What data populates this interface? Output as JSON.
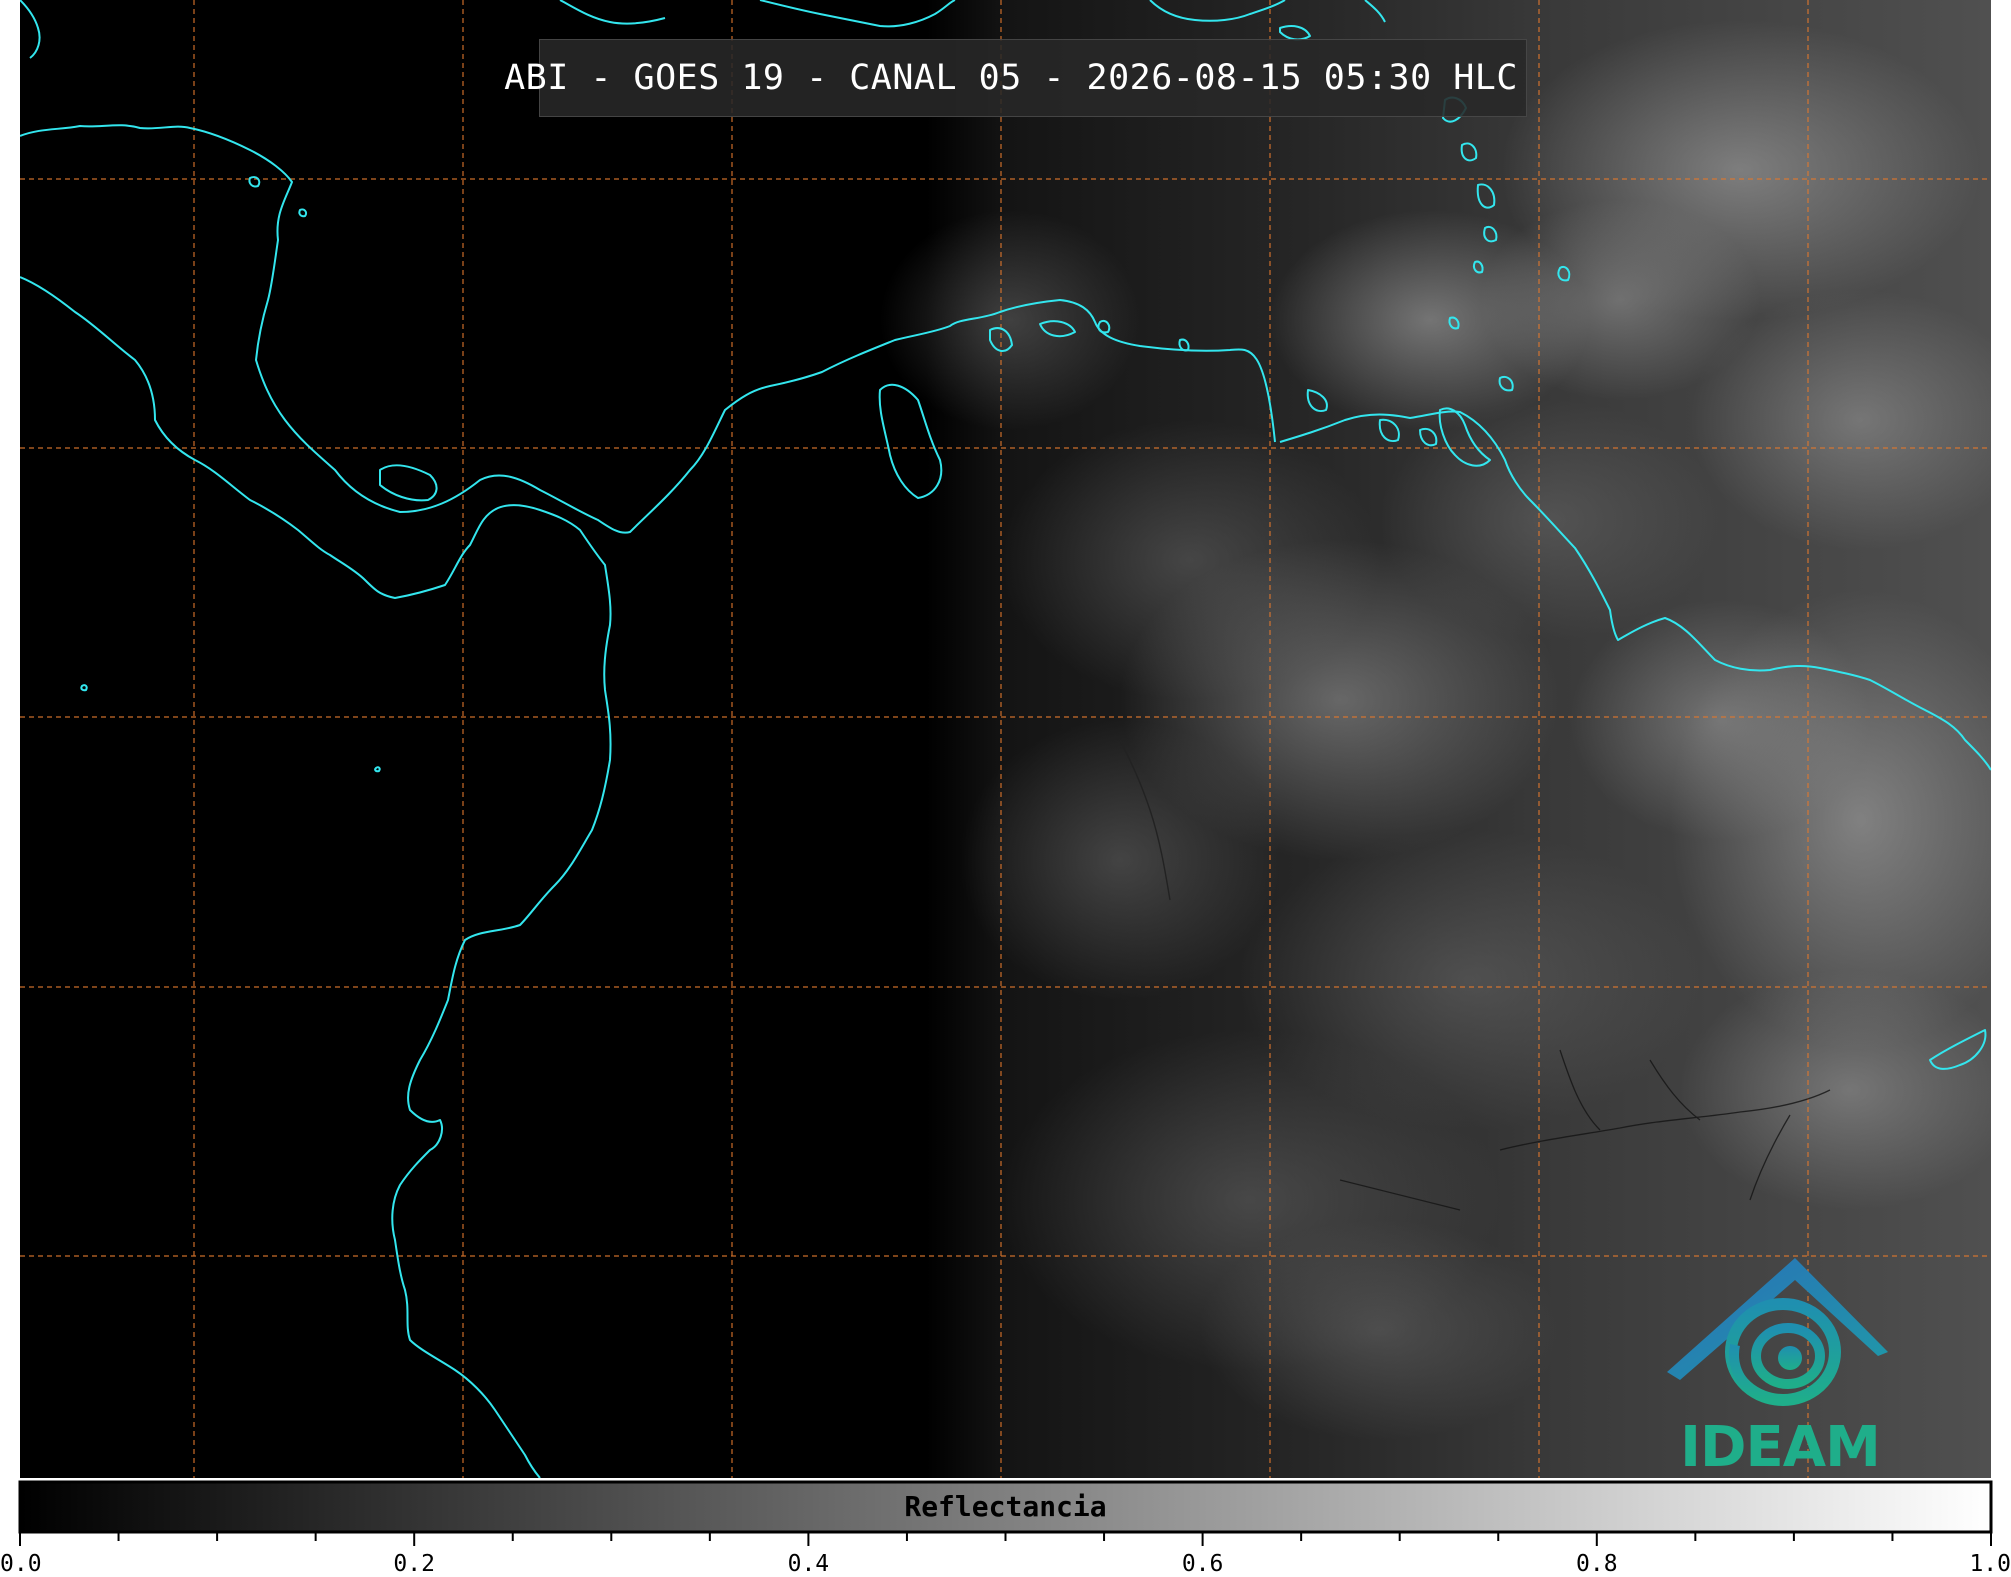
{
  "map": {
    "title": "ABI - GOES 19 - CANAL 05 - 2026-08-15 05:30 HLC",
    "coastline_color": "#33e6ee",
    "gridline_color": "#e0782e",
    "background_color": "#000000"
  },
  "colorbar": {
    "label": "Reflectancia",
    "min": 0.0,
    "max": 1.0,
    "tick_labels": [
      "0.0",
      "0.2",
      "0.4",
      "0.6",
      "0.8",
      "1.0"
    ],
    "tick_values": [
      0.0,
      0.2,
      0.4,
      0.6,
      0.8,
      1.0
    ],
    "minor_tick_step": 0.05,
    "colormap": "greys"
  },
  "logo": {
    "text": "IDEAM",
    "text_color": "#1fae8a",
    "roof_color": "#2a6fb8"
  }
}
